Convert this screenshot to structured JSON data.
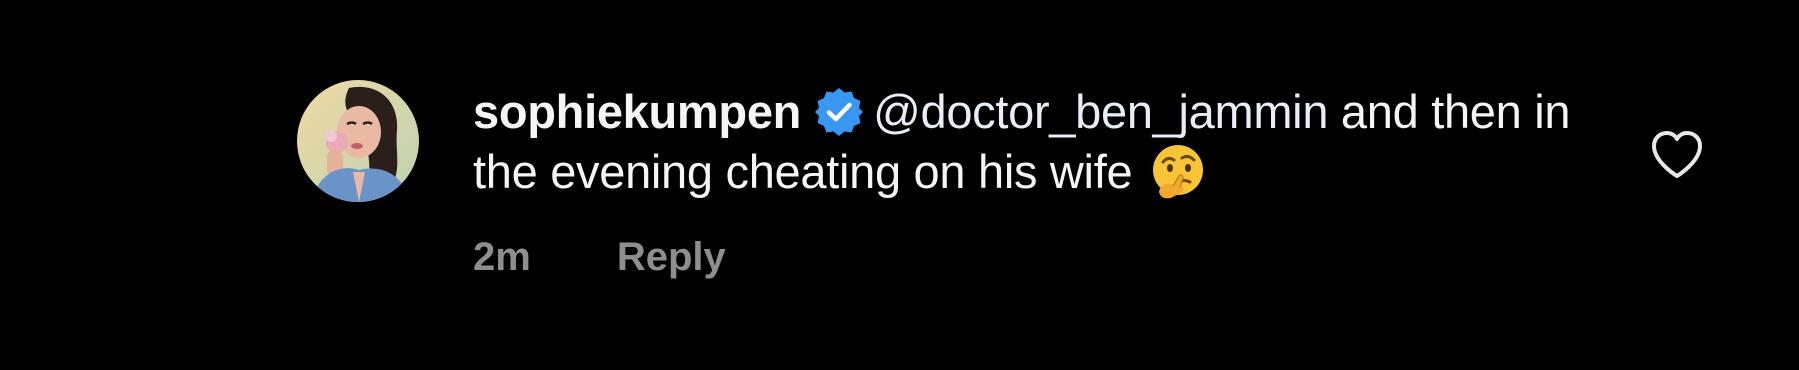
{
  "comment": {
    "username": "sophiekumpen",
    "mention": "@doctor_ben_jammin",
    "text": " and then in the evening cheating on his wife",
    "emoji": "thinking-face-emoji",
    "timestamp": "2m",
    "reply_label": "Reply",
    "verified_icon": "verified-badge-icon",
    "like_icon": "heart-outline-icon"
  },
  "colors": {
    "background": "#000000",
    "text": "#f5f5f5",
    "secondary_text": "#8e8e8e",
    "verified_blue": "#3897f0"
  }
}
